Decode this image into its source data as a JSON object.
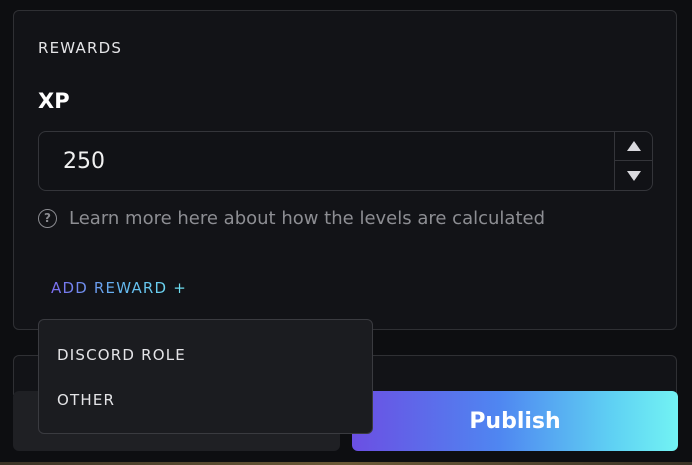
{
  "rewards": {
    "section_title": "REWARDS",
    "xp_label": "XP",
    "xp_value": "250",
    "help_text": "Learn more here about how the levels are calculated",
    "help_icon": "?",
    "add_reward_label": "ADD REWARD +"
  },
  "dropdown": {
    "items": [
      {
        "label": "DISCORD ROLE"
      },
      {
        "label": "OTHER"
      }
    ]
  },
  "footer": {
    "secondary_label": "",
    "publish_label": "Publish"
  },
  "colors": {
    "background": "#0d0e11",
    "panel": "#121317",
    "accent_start": "#6b4fe3",
    "accent_end": "#72f3f3"
  }
}
